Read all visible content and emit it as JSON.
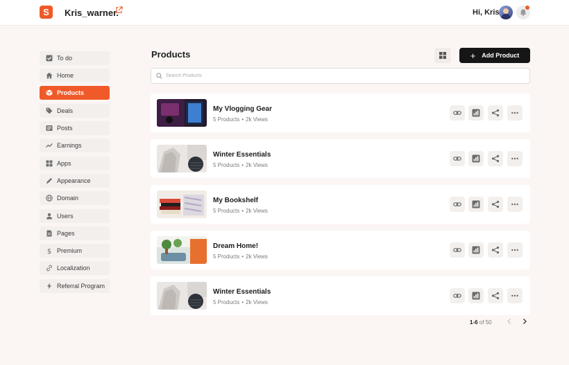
{
  "header": {
    "brand": "Kris_warner.",
    "logo_letter": "S",
    "greeting": "Hi, Kris"
  },
  "colors": {
    "accent": "#f05a28",
    "dark": "#161616",
    "background": "#fbf6f4"
  },
  "sidebar": {
    "items": [
      {
        "label": "To do",
        "icon": "checkbox-icon"
      },
      {
        "label": "Home",
        "icon": "home-icon"
      },
      {
        "label": "Products",
        "icon": "box-icon",
        "active": true
      },
      {
        "label": "Deals",
        "icon": "tag-icon"
      },
      {
        "label": "Posts",
        "icon": "posts-icon"
      },
      {
        "label": "Earnings",
        "icon": "trend-icon"
      },
      {
        "label": "Apps",
        "icon": "apps-icon"
      },
      {
        "label": "Appearance",
        "icon": "pen-icon"
      },
      {
        "label": "Domain",
        "icon": "globe-icon"
      },
      {
        "label": "Users",
        "icon": "user-icon"
      },
      {
        "label": "Pages",
        "icon": "page-icon"
      },
      {
        "label": "Premium",
        "icon": "dollar-icon"
      },
      {
        "label": "Localization",
        "icon": "link-icon"
      },
      {
        "label": "Referral Program",
        "icon": "bolt-icon"
      }
    ]
  },
  "main": {
    "title": "Products",
    "add_label": "Add Product",
    "search_placeholder": "Search Products",
    "products": [
      {
        "title": "My Vlogging Gear",
        "count": "5 Products",
        "views": "2k Views",
        "thumb": "gear"
      },
      {
        "title": "Winter Essentials",
        "count": "5 Products",
        "views": "2k Views",
        "thumb": "winter"
      },
      {
        "title": "My Bookshelf",
        "count": "5 Products",
        "views": "2k Views",
        "thumb": "books"
      },
      {
        "title": "Dream Home!",
        "count": "5 Products",
        "views": "2k Views",
        "thumb": "home"
      },
      {
        "title": "Winter Essentials",
        "count": "5 Products",
        "views": "2k Views",
        "thumb": "winter"
      }
    ],
    "pager": {
      "range": "1-6",
      "of_label": "of 50"
    }
  }
}
